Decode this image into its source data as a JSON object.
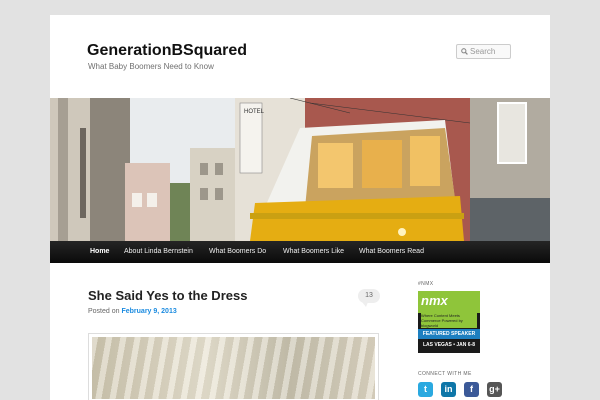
{
  "site": {
    "title": "GenerationBSquared",
    "description": "What Baby Boomers Need to Know"
  },
  "search": {
    "placeholder": "Search",
    "icon": "search-icon"
  },
  "nav": {
    "items": [
      {
        "label": "Home",
        "active": true
      },
      {
        "label": "About Linda Bernstein",
        "active": false
      },
      {
        "label": "What Boomers Do",
        "active": false
      },
      {
        "label": "What Boomers Like",
        "active": false
      },
      {
        "label": "What Boomers Read",
        "active": false
      }
    ]
  },
  "post": {
    "title": "She Said Yes to the Dress",
    "posted_prefix": "Posted on",
    "date": "February 9, 2013",
    "comment_count": "13"
  },
  "sidebar": {
    "nmx_title": "#NMX",
    "nmx_badge": {
      "logo": "nmx",
      "tagline": "Where Content Meets Commerce Powered by blogworld",
      "featured": "FEATURED SPEAKER",
      "date": "LAS VEGAS • JAN 6-8"
    },
    "connect_title": "CONNECT WITH ME",
    "social": [
      {
        "name": "twitter-icon",
        "glyph": "t",
        "color": "#2aa9e0"
      },
      {
        "name": "linkedin-icon",
        "glyph": "in",
        "color": "#0e76a8"
      },
      {
        "name": "facebook-icon",
        "glyph": "f",
        "color": "#3b5998"
      },
      {
        "name": "googleplus-icon",
        "glyph": "g+",
        "color": "#555555"
      }
    ]
  }
}
